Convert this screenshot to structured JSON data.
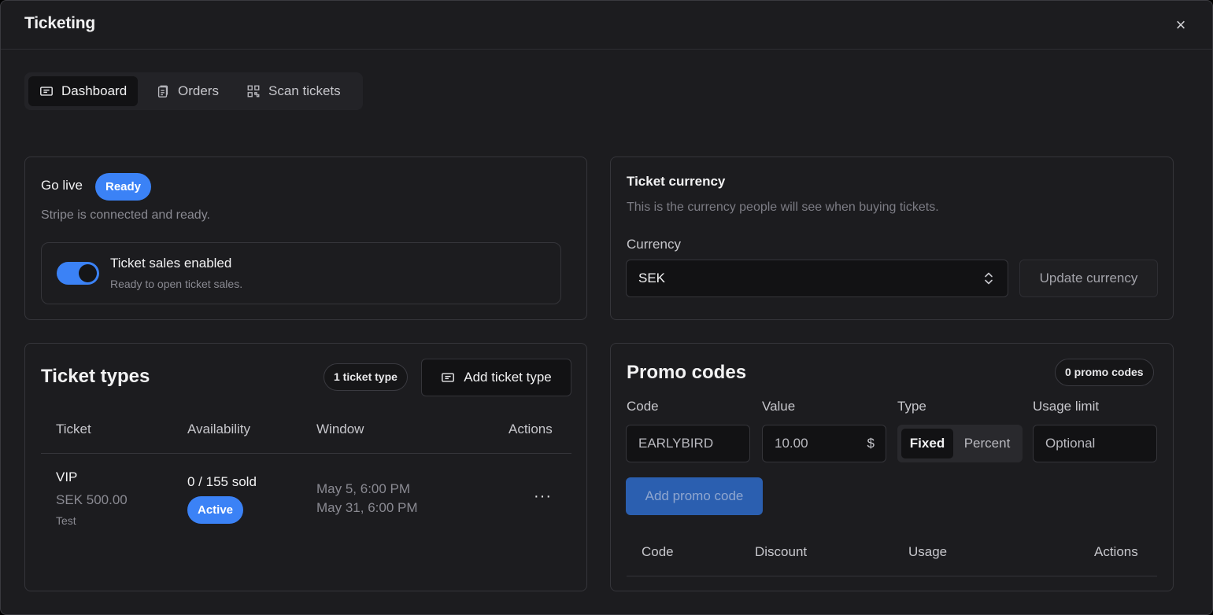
{
  "window": {
    "title": "Ticketing",
    "close_label": "×"
  },
  "tabs": [
    {
      "label": "Dashboard",
      "icon": "ticket-icon",
      "active": true
    },
    {
      "label": "Orders",
      "icon": "clipboard-icon",
      "active": false
    },
    {
      "label": "Scan tickets",
      "icon": "qr-code-icon",
      "active": false
    }
  ],
  "go_live": {
    "title": "Go live",
    "status_badge": "Ready",
    "subtitle": "Stripe is connected and ready.",
    "toggle": {
      "title": "Ticket sales enabled",
      "subtitle": "Ready to open ticket sales.",
      "enabled": true
    }
  },
  "currency": {
    "title": "Ticket currency",
    "subtitle": "This is the currency people will see when buying tickets.",
    "field_label": "Currency",
    "selected": "SEK",
    "update_button": "Update currency"
  },
  "ticket_types": {
    "title": "Ticket types",
    "count_badge": "1 ticket type",
    "add_button": "Add ticket type",
    "columns": [
      "Ticket",
      "Availability",
      "Window",
      "Actions"
    ],
    "rows": [
      {
        "name": "VIP",
        "price": "SEK 500.00",
        "description": "Test",
        "availability": "0 / 155 sold",
        "status": "Active",
        "window_start": "May 5, 6:00 PM",
        "window_end": "May 31, 6:00 PM",
        "actions": "···"
      }
    ]
  },
  "promo_codes": {
    "title": "Promo codes",
    "count_badge": "0 promo codes",
    "form": {
      "code_label": "Code",
      "code_placeholder": "EARLYBIRD",
      "value_label": "Value",
      "value_placeholder": "10.00",
      "value_suffix": "$",
      "type_label": "Type",
      "type_options": [
        "Fixed",
        "Percent"
      ],
      "type_selected": "Fixed",
      "usage_label": "Usage limit",
      "usage_placeholder": "Optional"
    },
    "add_button": "Add promo code",
    "columns": [
      "Code",
      "Discount",
      "Usage",
      "Actions"
    ]
  },
  "colors": {
    "accent": "#3b82f6",
    "background": "#1c1c1f",
    "border": "#35353a"
  }
}
